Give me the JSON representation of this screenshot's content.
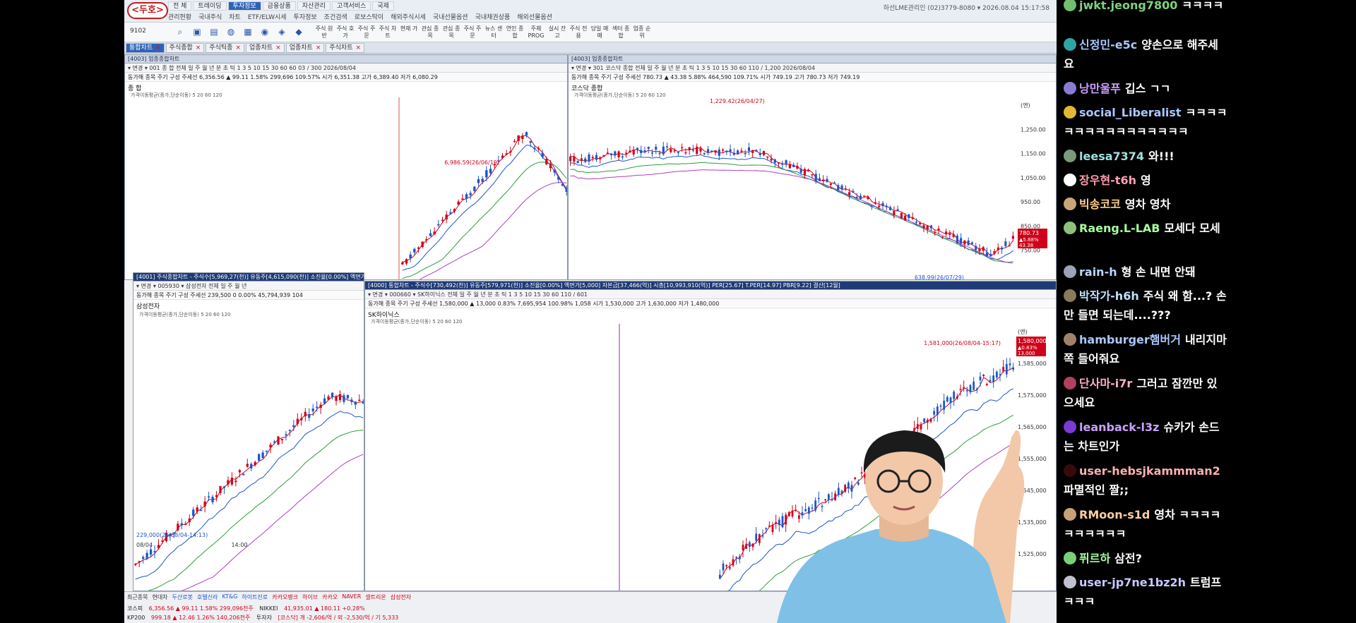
{
  "app": {
    "logo": "<두호>",
    "menu_top": [
      "전 체",
      "트레이딩",
      "투자정보",
      "금융상품",
      "자산관리",
      "고객서비스",
      "국제"
    ],
    "menu_top_active": 2,
    "menu_sub": [
      "관리현황",
      "국내주식",
      "차트",
      "ETF/ELW시세",
      "투자정보",
      "조건검색",
      "로보스탁이",
      "해외주식시세",
      "국내선물옵션",
      "국내채권상품",
      "해외선물옵션"
    ],
    "sysinfo": "하선LME관리인 (02)3779-8080 ▾  2026.08.04 15:17:58",
    "code_field": "9102",
    "tool_labels": [
      "주식 원반",
      "주식 호가",
      "주식 주문",
      "주식 차트",
      "현재 가",
      "관심 종목",
      "관심 종목",
      "주식 주문",
      "뉴스 센터",
      "연인 종합",
      "주체 PROG",
      "실시 잔고",
      "주식 전용",
      "당일 매매",
      "섹터 종합",
      "업종 순위"
    ],
    "tabs": [
      {
        "label": "통합차트",
        "active": true
      },
      {
        "label": "주식종합",
        "active": false
      },
      {
        "label": "주식틱종",
        "active": false
      },
      {
        "label": "업종차트",
        "active": false
      },
      {
        "label": "업종차트",
        "active": false
      },
      {
        "label": "주식차트",
        "active": false
      }
    ]
  },
  "windows": [
    {
      "id": "kospi",
      "title": "[4003] 업종종합차트",
      "controls": "▾ 면경 ▾  001   종    합    전체  일 주 월 년 분 초 틱  1 3 5 10 15 30 60   60   03 / 300   2026/08/04",
      "price_row": "동가해  종목  주기  구성  주세선  6,356.56 ▲ 99.11 1.58%  299,696  109.57%  시가 6,351.38  고가 6,389.40  저가 6,080.29",
      "name": "종 합",
      "indicator": "가격이동평균(종가,단순이동) 5 20 60 120",
      "high_label": "6,986.59(26/06/19)"
    },
    {
      "id": "kosdaq",
      "title": "[4003] 업종종합차트",
      "controls": "▾ 면경 ▾  301   코스닥 종합   전체  일 주 월 년 분 초 틱  1 3 5 10 15 30 60   110 / 1,200   2026/08/04",
      "price_row": "동가해  종목  주기  구성  주세선  780.73 ▲ 43.38 5.88%  464,590  109.71%  시가 749.19  고가 780.73  저가 749.19",
      "name": "코스닥 종합",
      "indicator": "가격이동평균(종가,단순이동) 5 20 60 120",
      "high_label": "1,229.42(26/04/27)",
      "low_label": "638.99(26/07/29)",
      "price_tag": "780.73",
      "change_tag": "▲5.88%",
      "amount_tag": "43.38",
      "y_ticks": [
        "(엔)",
        "1,250.00",
        "1,150.00",
        "1,050.00",
        "950.00",
        "850.00",
        "750.00"
      ]
    },
    {
      "id": "samsung",
      "title": "[4001] 주식종합차트 - 주식수[5,969,27(천)] 유동주[4,615,090(천)] 소진율[0.00%] 액면가[100] 자본금[7,780(억)] 시총[13,475,679(억)]",
      "controls": "▾ 면경 ▾  005930  ▾   삼성전자   전체  일 주 월 년",
      "price_row": "동가해  종목  주기  구성  주세선  239,500   0  0.00%  45,794,939  104",
      "name": "삼성전자",
      "indicator": "가격이동평균(종가,단순이동) 5 20 60 120",
      "low_label": "229,000(26/08/04-14:13)",
      "date_left": "08/04",
      "date_mid": "14:00"
    },
    {
      "id": "skhynix",
      "title": "[4000] 통합차트 - 주식수[730,492(천)] 유동주[579,971(천)] 소진율[0.00%] 액면가[5,000] 자본금[37,466(억)] 시총[10,993,910(억)] PER[25.67] T.PER[14.97] PBR[9.22] 결산[12월]",
      "controls": "▾ 면경 ▾  000660  ▾   SK하이닉스   전체  일 주 월 년 분 초 틱  1 3 5 10 15 30 60   110 / 601",
      "price_row": "동가해  종목  주기  구성  주세선  1,580,000 ▲ 13,000  0.83%  7,695,954  100.98%  1,058  시가 1,530,000  고가 1,630,000  저가 1,480,000",
      "name": "SK하이닉스",
      "indicator": "가격이동평균(종가,단순이동) 5 20 60 120",
      "high_label": "1,581,000(26/08/04-15:17)",
      "price_tag": "1,580,000",
      "change_tag": "▲0.83%",
      "amount_tag": "13,000",
      "y_ticks": [
        "(엔)",
        "1,585,000",
        "1,575,000",
        "1,565,000",
        "1,555,000",
        "1,545,000",
        "1,535,000",
        "1,525,000"
      ]
    }
  ],
  "bottom": {
    "tickers": [
      {
        "text": "최근종목",
        "cls": ""
      },
      {
        "text": "현대차",
        "cls": ""
      },
      {
        "text": "두산로봇",
        "cls": "dn"
      },
      {
        "text": "호텔신라",
        "cls": "dn"
      },
      {
        "text": "KT&G",
        "cls": "dn"
      },
      {
        "text": "하이트진로",
        "cls": "dn"
      },
      {
        "text": "카카오뱅크",
        "cls": "up"
      },
      {
        "text": "하이브",
        "cls": "up"
      },
      {
        "text": "카카오",
        "cls": "up"
      },
      {
        "text": "NAVER",
        "cls": "up"
      },
      {
        "text": "셀트리온",
        "cls": "up"
      },
      {
        "text": "삼성전자",
        "cls": "up"
      }
    ],
    "row1": {
      "label": "코스피",
      "value": "6,356.56 ▲ 99.11 1.58%  299,096천주",
      "label2": "NIKKEI",
      "value2": "41,935.01 ▲ 180.11 +0.28%"
    },
    "row2": {
      "label": "KP200",
      "value": "999.18 ▲ 12.46 1.26%  140,206천주",
      "label2": "투자자",
      "value2": "[코스닥] 개 -2,606/억 / 외 -2,530/억 / 기 5,333"
    }
  },
  "chat": [
    {
      "nick": "jwkt.jeong7800",
      "text": "ㅋㅋㅋㅋ",
      "nick_color": "#7fd17f",
      "av": "#6fbf6f",
      "y": -6
    },
    {
      "nick": "신정민-e5c",
      "text": "양손으로 해주세요",
      "nick_color": "#a9c8ff",
      "av": "#2fa4a4",
      "y": 50
    },
    {
      "nick": "낭만울푸",
      "text": "깁스 ㄱㄱ",
      "nick_color": "#c8a0ff",
      "av": "#8a7cd6",
      "y": 112
    },
    {
      "nick": "social_Liberalist",
      "text": "ㅋㅋㅋㅋㅋㅋㅋㅋㅋㅋㅋㅋㅋㅋㅋㅋ",
      "nick_color": "#a9c8ff",
      "av": "#e2b833",
      "y": 146
    },
    {
      "nick": "leesa7374",
      "text": "와!!!",
      "nick_color": "#9fe0e0",
      "av": "#7a9a7a",
      "y": 208
    },
    {
      "nick": "장우현-t6h",
      "text": "영",
      "nick_color": "#ff9fb0",
      "av": "#ffffff",
      "y": 242
    },
    {
      "nick": "빅송코코",
      "text": "영차 영차",
      "nick_color": "#ffd08a",
      "av": "#c9a67a",
      "y": 276
    },
    {
      "nick": "Raeng.L-LAB",
      "text": "모세다 모세",
      "nick_color": "#a8ff9f",
      "av": "#8fc07a",
      "y": 310
    },
    {
      "nick": "rain-h",
      "text": "형 손 내면 안돼",
      "nick_color": "#b9d8ff",
      "av": "#9aa4b4",
      "y": 372
    },
    {
      "nick": "박작가-h6h",
      "text": "주식 왜 함...? 손만 들면 되는데....???",
      "nick_color": "#c0e0ff",
      "av": "#8a7a5a",
      "y": 406
    },
    {
      "nick": "hamburger햄버거",
      "text": "내리지마 쪽 들어줘요",
      "nick_color": "#a9c8ff",
      "av": "#a0826a",
      "y": 468
    },
    {
      "nick": "단사마-i7r",
      "text": "그러고 잠깐만 있으세요",
      "nick_color": "#ffb0c8",
      "av": "#b04060",
      "y": 530
    },
    {
      "nick": "leanback-l3z",
      "text": "슈카가 손드는 차트인가",
      "nick_color": "#c8a0ff",
      "av": "#7a3ad6",
      "y": 592
    },
    {
      "nick": "user-hebsjkammman2",
      "text": "파멸적인 짤;;",
      "nick_color": "#ffb0b0",
      "av": "#3a0a0a",
      "y": 654
    },
    {
      "nick": "RMoon-s1d",
      "text": "영차 ㅋㅋㅋㅋㅋㅋㅋㅋㅋㅋ",
      "nick_color": "#ffd0a0",
      "av": "#c8a07a",
      "y": 716
    },
    {
      "nick": "퓌르하",
      "text": "삼전?",
      "nick_color": "#a8ff9f",
      "av": "#7ad07a",
      "y": 778
    },
    {
      "nick": "user-jp7ne1bz2h",
      "text": "트럼프 ㅋㅋㅋ",
      "nick_color": "#c8c8ff",
      "av": "#c0c0d0",
      "y": 812
    }
  ],
  "colors": {
    "up": "#d0021b",
    "down": "#1c56c9",
    "ma5": "#d0021b",
    "ma20": "#1c56c9",
    "ma60": "#2e9d3a",
    "ma120": "#b03cc8",
    "accent": "#2f62b7"
  }
}
